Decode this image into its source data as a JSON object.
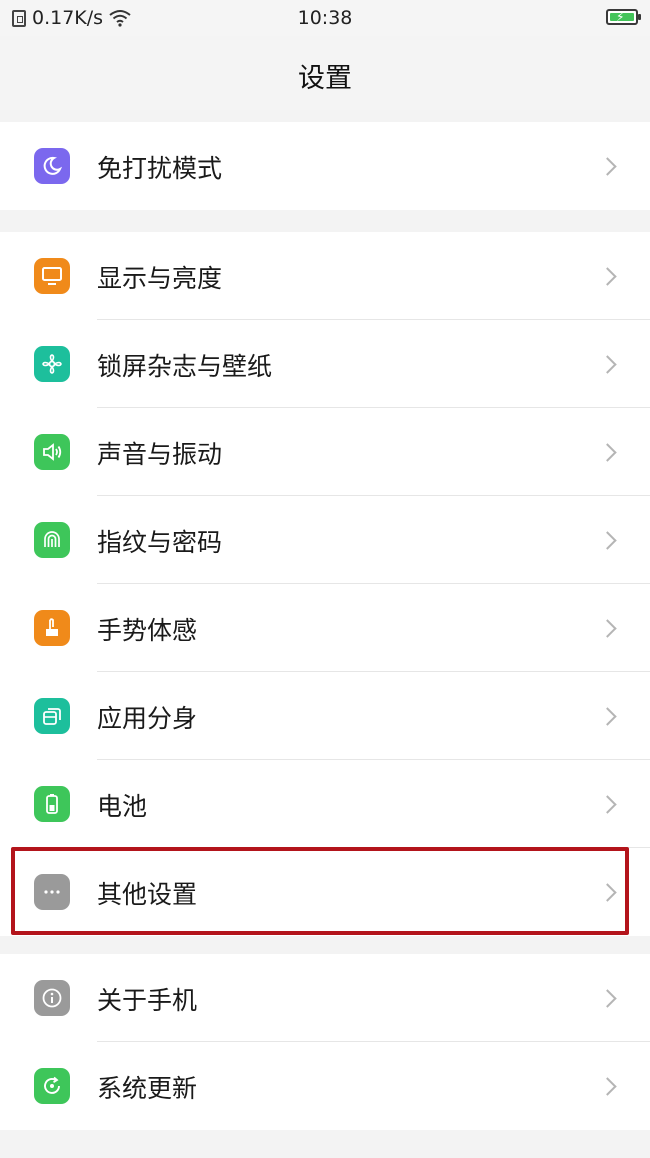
{
  "status": {
    "speed": "0.17K/s",
    "time": "10:38"
  },
  "header": {
    "title": "设置"
  },
  "groups": [
    {
      "items": [
        {
          "label": "免打扰模式",
          "icon": "moon-icon",
          "color": "#7b68ee"
        }
      ]
    },
    {
      "items": [
        {
          "label": "显示与亮度",
          "icon": "display-icon",
          "color": "#f08a1a"
        },
        {
          "label": "锁屏杂志与壁纸",
          "icon": "flower-icon",
          "color": "#1dbf9c"
        },
        {
          "label": "声音与振动",
          "icon": "speaker-icon",
          "color": "#3ec65a"
        },
        {
          "label": "指纹与密码",
          "icon": "fingerprint-icon",
          "color": "#3ec65a"
        },
        {
          "label": "手势体感",
          "icon": "hand-icon",
          "color": "#f08a1a"
        },
        {
          "label": "应用分身",
          "icon": "clone-icon",
          "color": "#1dbf9c"
        },
        {
          "label": "电池",
          "icon": "battery-icon",
          "color": "#3ec65a"
        },
        {
          "label": "其他设置",
          "icon": "more-icon",
          "color": "#9a9a9a"
        }
      ]
    },
    {
      "items": [
        {
          "label": "关于手机",
          "icon": "info-icon",
          "color": "#9a9a9a"
        },
        {
          "label": "系统更新",
          "icon": "update-icon",
          "color": "#3ec65a"
        }
      ]
    }
  ]
}
